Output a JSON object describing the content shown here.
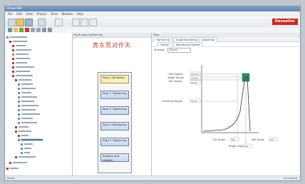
{
  "window": {
    "title": "Pewa SW"
  },
  "menubar": [
    "File",
    "Edit",
    "View",
    "Project",
    "Tools",
    "Window",
    "Help"
  ],
  "brand": {
    "logo": "Desoutter",
    "accent": "#c52a22"
  },
  "left_panel": {
    "icons": [
      "tree-icon",
      "folder-icon",
      "add-icon",
      "delete-icon",
      "copy-icon",
      "paste-icon",
      "search-icon",
      "settings-icon"
    ],
    "tree_colors": [
      "#c0392b",
      "#6b8fb5",
      "#9aa6b2",
      "#7a9e3b"
    ]
  },
  "middle_panel": {
    "header": "Multi-step tightening",
    "title": "真东莞对作夫",
    "steps": [
      "Step 1 Rundown",
      "Step 2 Tightening",
      "Step 3 Tightening",
      "Step 4 Monitoring",
      "Step 5 Tightening",
      "Release and Untight"
    ]
  },
  "right_panel": {
    "header": "Step",
    "tabs": [
      "Tightening",
      "Angle Monitoring",
      "Loosening"
    ],
    "subtabs": [
      "Torque",
      "Monitoring Control"
    ],
    "field": {
      "label": "Strategy",
      "value": "Torque"
    },
    "graph_labels": {
      "max_torque": "Max Torque",
      "target": "Target Torque",
      "min_torque": "Min Torque",
      "threshold": "Threshold Torque",
      "min_angle": "Min Angle",
      "max_angle": "Max Angle",
      "target_angle": "Target Angle"
    },
    "fields": [
      "110.00",
      "100.00",
      "90.00",
      "20.00",
      "360",
      "720",
      "540"
    ]
  },
  "statusbar": {
    "text": "Ready",
    "right": "Connected"
  }
}
